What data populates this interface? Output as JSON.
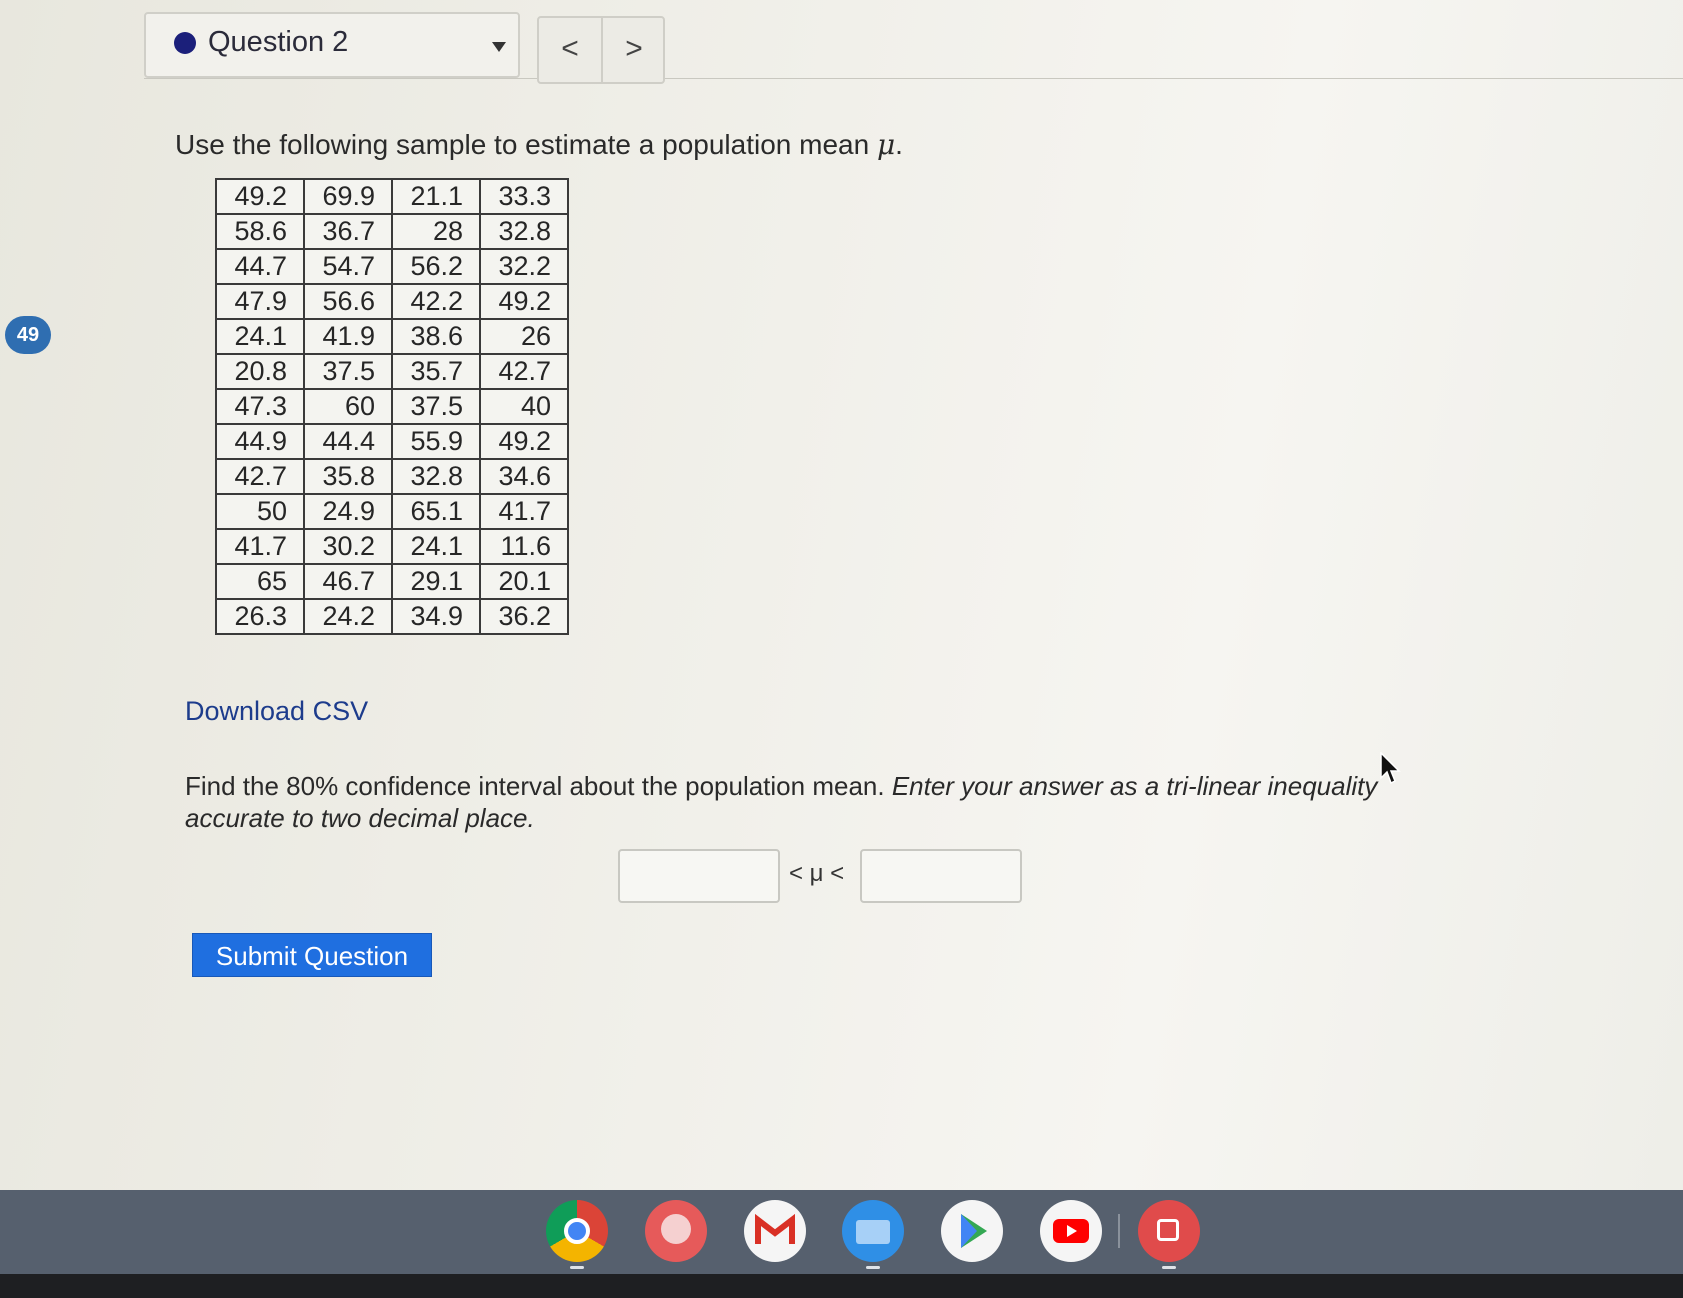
{
  "header": {
    "question_label": "Question 2",
    "prev_label": "<",
    "next_label": ">"
  },
  "badge": "49",
  "prompt": {
    "text": "Use the following sample to estimate a population mean ",
    "symbol": "μ",
    "end": "."
  },
  "table": {
    "rows": [
      [
        "49.2",
        "69.9",
        "21.1",
        "33.3"
      ],
      [
        "58.6",
        "36.7",
        "28",
        "32.8"
      ],
      [
        "44.7",
        "54.7",
        "56.2",
        "32.2"
      ],
      [
        "47.9",
        "56.6",
        "42.2",
        "49.2"
      ],
      [
        "24.1",
        "41.9",
        "38.6",
        "26"
      ],
      [
        "20.8",
        "37.5",
        "35.7",
        "42.7"
      ],
      [
        "47.3",
        "60",
        "37.5",
        "40"
      ],
      [
        "44.9",
        "44.4",
        "55.9",
        "49.2"
      ],
      [
        "42.7",
        "35.8",
        "32.8",
        "34.6"
      ],
      [
        "50",
        "24.9",
        "65.1",
        "41.7"
      ],
      [
        "41.7",
        "30.2",
        "24.1",
        "11.6"
      ],
      [
        "65",
        "46.7",
        "29.1",
        "20.1"
      ],
      [
        "26.3",
        "24.2",
        "34.9",
        "36.2"
      ]
    ]
  },
  "download_link": "Download CSV",
  "question": {
    "plain": "Find the 80% confidence interval about the population mean. ",
    "italic": "Enter your answer as a tri-linear inequality accurate to two decimal place."
  },
  "answer": {
    "lower_value": "",
    "upper_value": "",
    "inequality": "< μ <"
  },
  "submit_label": "Submit Question",
  "shelf": {
    "apps": [
      "chrome-icon",
      "canvas-icon",
      "gmail-icon",
      "files-icon",
      "play-store-icon",
      "youtube-icon",
      "screencast-icon"
    ]
  }
}
